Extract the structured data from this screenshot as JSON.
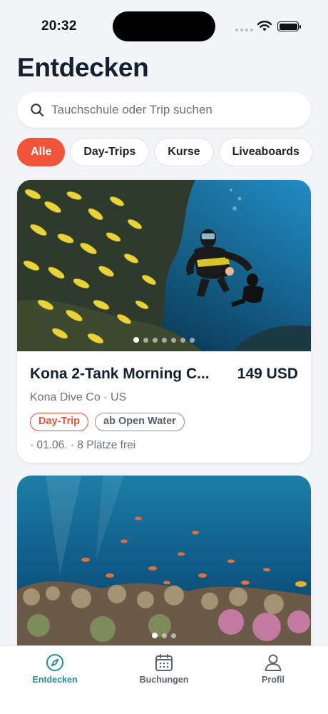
{
  "status_bar": {
    "time": "20:32"
  },
  "header": {
    "title": "Entdecken"
  },
  "search": {
    "placeholder": "Tauchschule oder Trip suchen"
  },
  "filters": {
    "chips": [
      "Alle",
      "Day-Trips",
      "Kurse",
      "Liveaboards"
    ],
    "active_index": 0
  },
  "cards": [
    {
      "title": "Kona 2-Tank Morning C...",
      "price": "149 USD",
      "operator_line": "Kona Dive Co · US",
      "tags": [
        "Day-Trip",
        "ab Open Water"
      ],
      "meta": "· 01.06. · 8 Plätze frei",
      "image_slides": 7,
      "image_active_slide": 0
    },
    {
      "image_slides": 3,
      "image_active_slide": 0
    }
  ],
  "tab_bar": {
    "items": [
      {
        "label": "Entdecken",
        "icon": "compass-icon",
        "active": true
      },
      {
        "label": "Buchungen",
        "icon": "calendar-icon",
        "active": false
      },
      {
        "label": "Profil",
        "icon": "person-icon",
        "active": false
      }
    ]
  },
  "colors": {
    "accent": "#f0553b",
    "tab_active": "#1f8f95",
    "tag_red": "#e8533b"
  }
}
